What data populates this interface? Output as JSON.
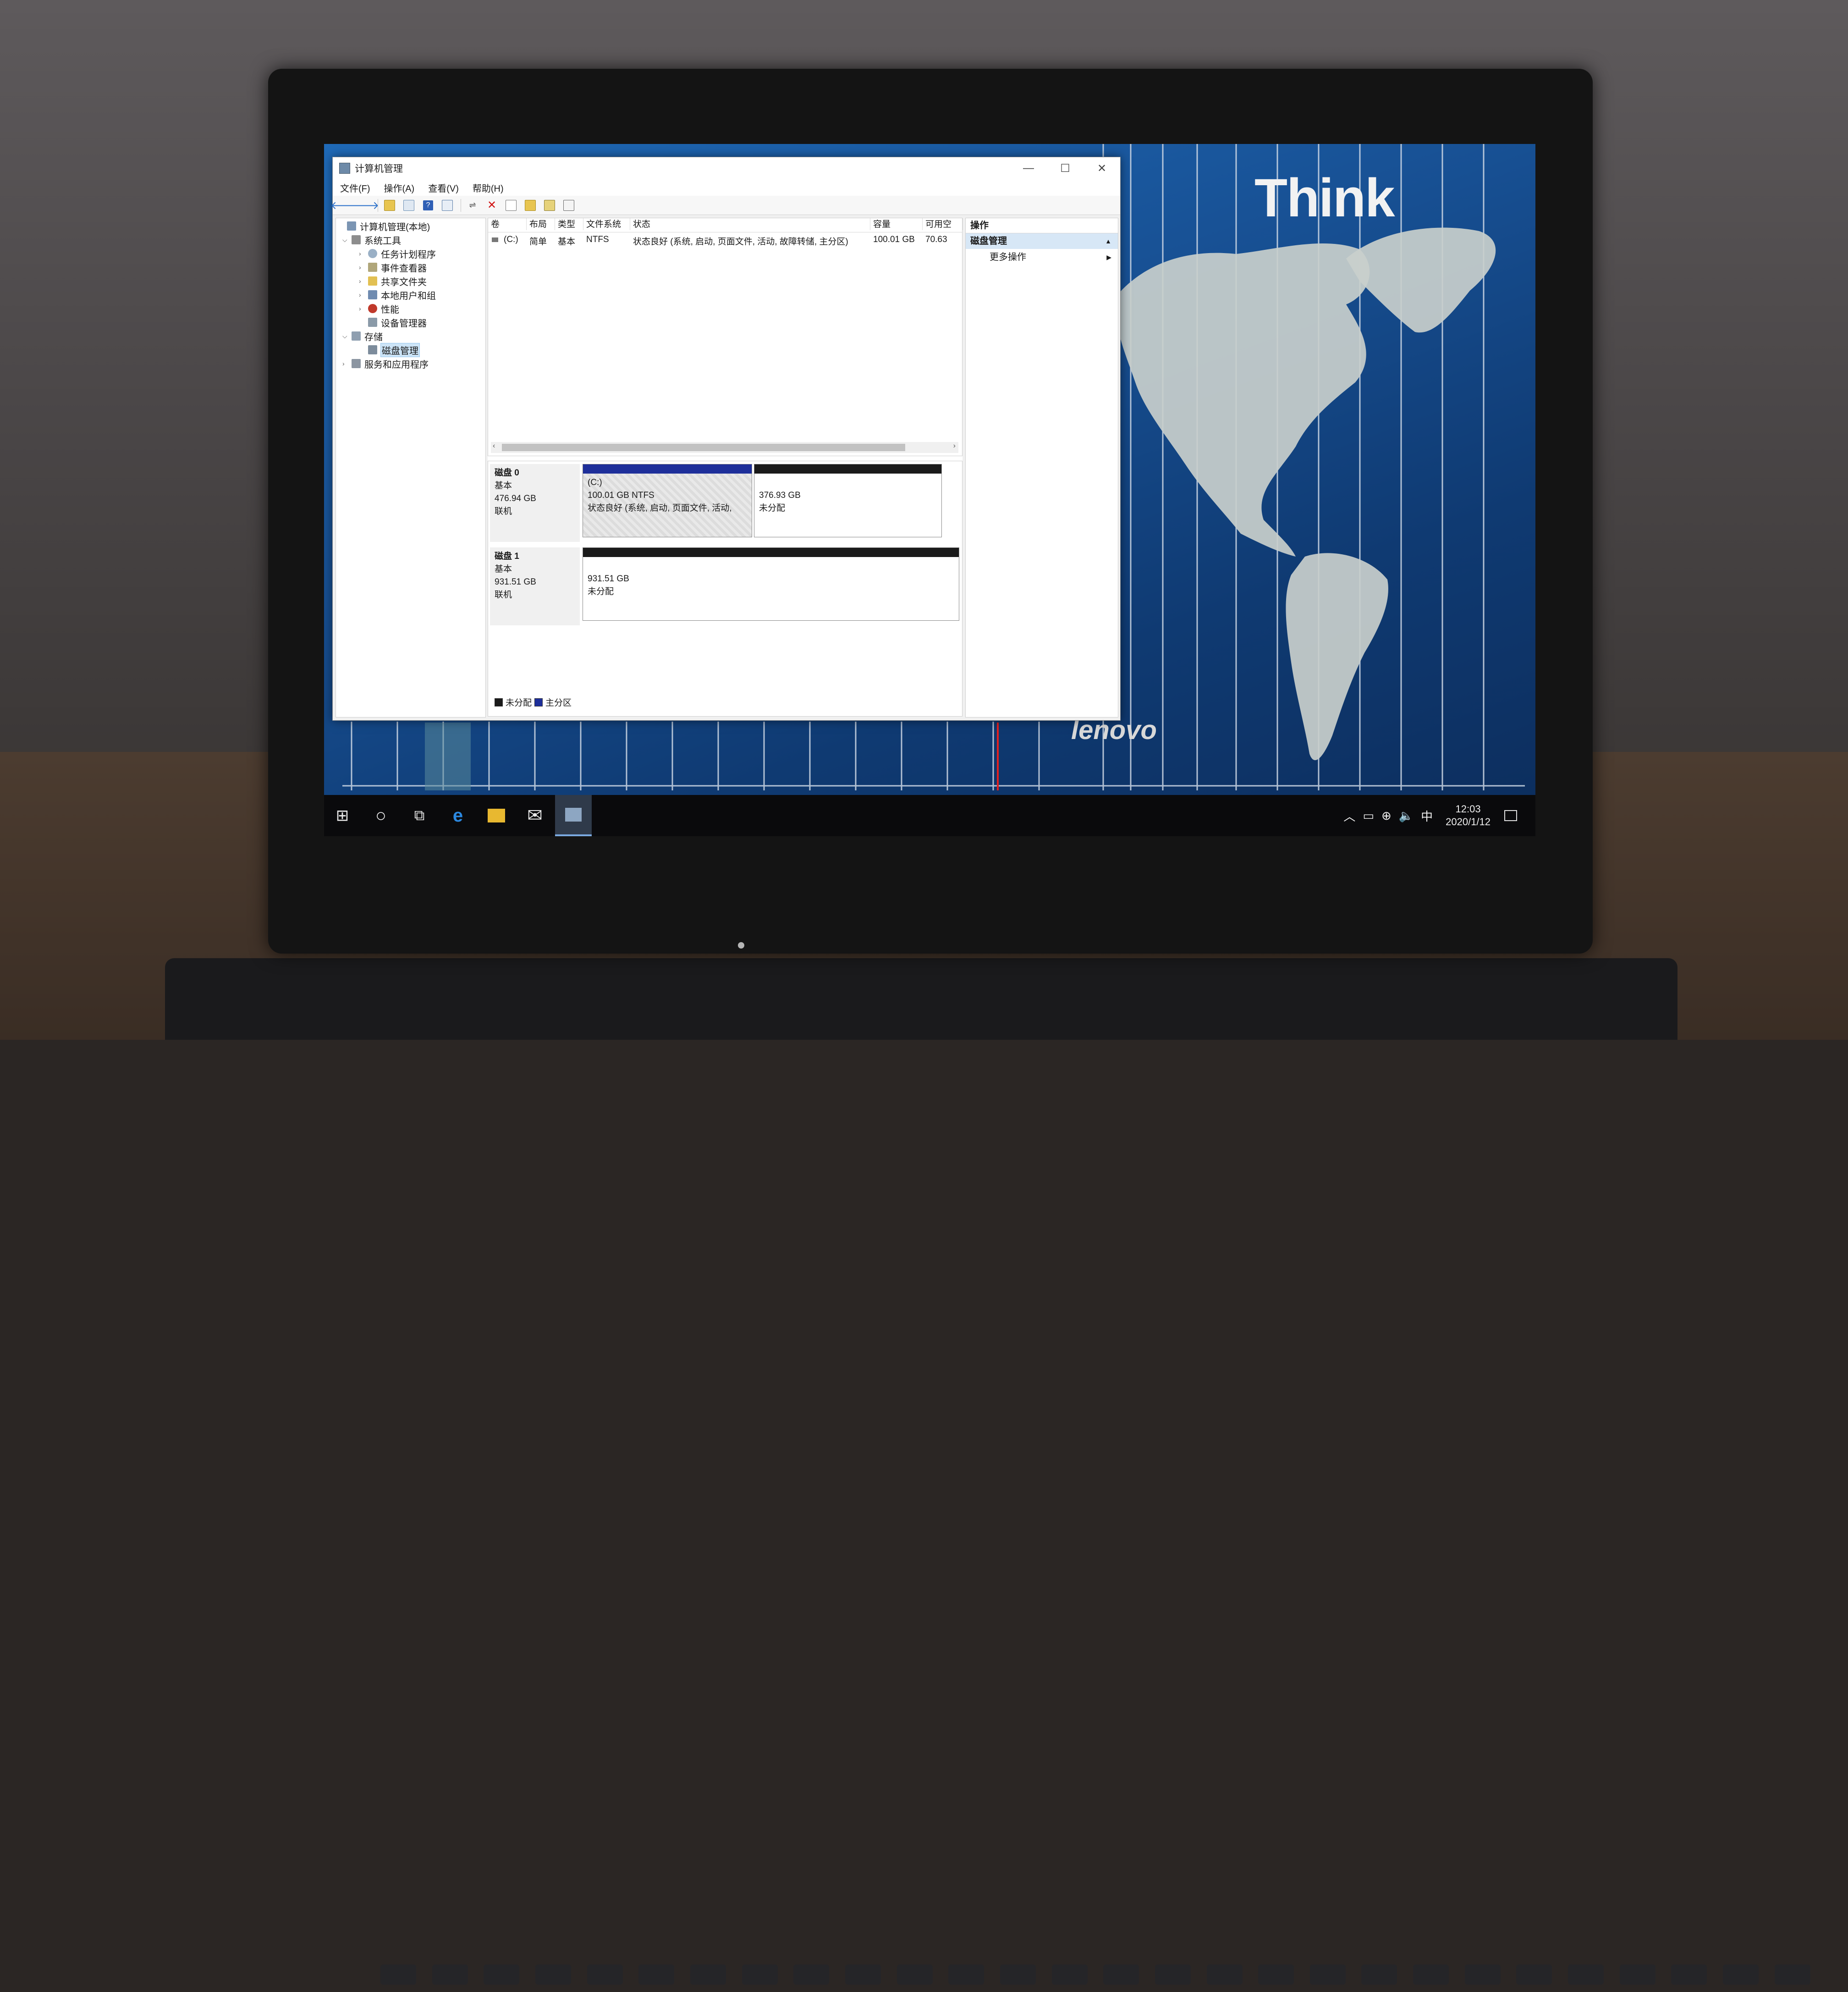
{
  "window": {
    "title": "计算机管理",
    "controls": {
      "minimize": "—",
      "maximize": "☐",
      "close": "✕"
    }
  },
  "menu": [
    "文件(F)",
    "操作(A)",
    "查看(V)",
    "帮助(H)"
  ],
  "toolbar_icons": [
    "back-icon",
    "forward-icon",
    "up-folder-icon",
    "show-hide-tree-icon",
    "help-icon",
    "properties-icon",
    "connect-icon",
    "delete-icon",
    "check-icon",
    "folder-icon",
    "search-icon",
    "view-icon"
  ],
  "tree": [
    {
      "label": "计算机管理(本地)",
      "level": 0,
      "expanded": true,
      "icon": "computer-icon"
    },
    {
      "label": "系统工具",
      "level": 1,
      "expanded": true,
      "icon": "tools-icon"
    },
    {
      "label": "任务计划程序",
      "level": 2,
      "expanded": false,
      "icon": "clock-icon"
    },
    {
      "label": "事件查看器",
      "level": 2,
      "expanded": false,
      "icon": "event-icon"
    },
    {
      "label": "共享文件夹",
      "level": 2,
      "expanded": false,
      "icon": "shared-folder-icon"
    },
    {
      "label": "本地用户和组",
      "level": 2,
      "expanded": false,
      "icon": "users-icon"
    },
    {
      "label": "性能",
      "level": 2,
      "expanded": false,
      "icon": "performance-icon"
    },
    {
      "label": "设备管理器",
      "level": 2,
      "expanded": false,
      "icon": "device-icon"
    },
    {
      "label": "存储",
      "level": 1,
      "expanded": true,
      "icon": "storage-icon"
    },
    {
      "label": "磁盘管理",
      "level": 2,
      "expanded": false,
      "selected": true,
      "icon": "disk-icon"
    },
    {
      "label": "服务和应用程序",
      "level": 1,
      "expanded": false,
      "icon": "services-icon"
    }
  ],
  "volume_list": {
    "columns": [
      "卷",
      "布局",
      "类型",
      "文件系统",
      "状态",
      "容量",
      "可用空"
    ],
    "rows": [
      [
        "(C:)",
        "简单",
        "基本",
        "NTFS",
        "状态良好 (系统, 启动, 页面文件, 活动, 故障转储, 主分区)",
        "100.01 GB",
        "70.63"
      ]
    ]
  },
  "disks": [
    {
      "name": "磁盘 0",
      "type": "基本",
      "size": "476.94 GB",
      "status": "联机",
      "partitions": [
        {
          "title": "(C:)",
          "line1": "100.01 GB NTFS",
          "line2": "状态良好 (系统, 启动, 页面文件, 活动,",
          "kind": "primary"
        },
        {
          "title": "",
          "line1": "376.93 GB",
          "line2": "未分配",
          "kind": "unallocated"
        }
      ]
    },
    {
      "name": "磁盘 1",
      "type": "基本",
      "size": "931.51 GB",
      "status": "联机",
      "partitions": [
        {
          "title": "",
          "line1": "931.51 GB",
          "line2": "未分配",
          "kind": "unallocated"
        }
      ]
    }
  ],
  "legend": [
    "未分配",
    "主分区"
  ],
  "actions": {
    "header": "操作",
    "section": "磁盘管理",
    "item": "更多操作"
  },
  "wallpaper": {
    "brand_top": "Think",
    "brand_bottom": "lenovo"
  },
  "taskbar": {
    "apps": [
      "start-icon",
      "cortana-icon",
      "task-view-icon",
      "edge-icon",
      "file-explorer-icon",
      "mail-icon",
      "computer-management-icon"
    ],
    "tray_ime": "中",
    "time": "12:03",
    "date": "2020/1/12"
  },
  "colors": {
    "unallocated": "#1a1a1a",
    "primary": "#1e2f9a",
    "desktop": "#174f92",
    "selection": "#cce4f7"
  }
}
